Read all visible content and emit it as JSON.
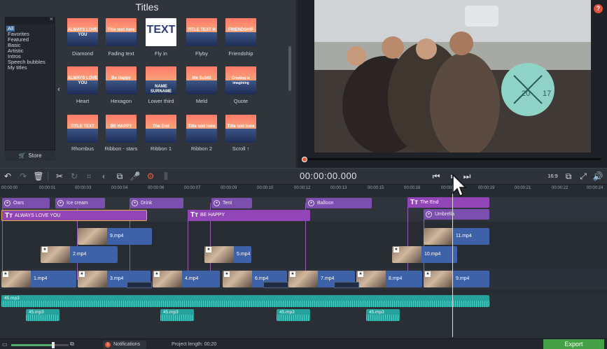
{
  "header": {
    "title": "Titles"
  },
  "categories": {
    "items": [
      "All",
      "Favorites",
      "Featured",
      "Basic",
      "Artistic",
      "Intros",
      "Speech bubbles",
      "My titles"
    ],
    "selected": "All",
    "store_label": "Store"
  },
  "tiles": [
    {
      "label": "Diamond",
      "text": "ALWAYS LOVE YOU"
    },
    {
      "label": "Fading text",
      "text": "Title text here"
    },
    {
      "label": "Fly in",
      "text": "TEXT"
    },
    {
      "label": "Flyby",
      "text": "TITLE TEXT H"
    },
    {
      "label": "Friendship",
      "text": "FRIENDSHIP"
    },
    {
      "label": "Heart",
      "text": "ALWAYS LOVE YOU"
    },
    {
      "label": "Hexagon",
      "text": "Be Happy"
    },
    {
      "label": "Lower third",
      "text": "NAME SURNAME"
    },
    {
      "label": "Meld",
      "text": "itle Subtit"
    },
    {
      "label": "Quote",
      "text": "Creating is imagining"
    },
    {
      "label": "Rhombus",
      "text": "TITLE TEXT"
    },
    {
      "label": "Ribbon - stars",
      "text": "BE HAPPY"
    },
    {
      "label": "Ribbon 1",
      "text": "The End"
    },
    {
      "label": "Ribbon 2",
      "text": "Title text here"
    },
    {
      "label": "Scroll ↑",
      "text": "Title text here"
    }
  ],
  "preview": {
    "badge_top": "20",
    "badge_right": "17",
    "help_label": "?"
  },
  "toolbar": {
    "timecode": "00:00:00.000",
    "aspect_ratio": "16:9"
  },
  "ruler": [
    "00:00:00",
    "00:00:01",
    "00:00:03",
    "00:00:04",
    "00:00:06",
    "00:00:07",
    "00:00:09",
    "00:00:10",
    "00:00:12",
    "00:00:13",
    "00:00:15",
    "00:00:16",
    "00:00:18",
    "00:00:19",
    "00:00:21",
    "00:00:22",
    "00:00:24"
  ],
  "sticker_clips": [
    "Oars",
    "Ice cream",
    "Drink",
    "Tent",
    "Balloon",
    "The End",
    "Umbrella"
  ],
  "title_clips": [
    "ALWAYS LOVE YOU",
    "BE HAPPY"
  ],
  "video_clips_top": [
    "9.mp4",
    "11.mp4"
  ],
  "video_clips_mid": [
    "2.mp4",
    "5.mp4",
    "10.mp4"
  ],
  "video_clips_main": [
    "1.mp4",
    "3.mp4",
    "4.mp4",
    "6.mp4",
    "7.mp4",
    "8.mp4",
    "9.mp4"
  ],
  "audio": {
    "main": "45.mp3",
    "small": [
      "45.mp3",
      "45.mp3",
      "45.mp3",
      "45.mp3"
    ]
  },
  "footer": {
    "notifications": "Notifications",
    "notification_count": "1",
    "project_length": "Project length:  00:20",
    "export": "Export"
  },
  "colors": {
    "accent_export": "#45a048",
    "title_track": "#9245b6",
    "video_track": "#3d62a8",
    "audio_track": "#27a29a"
  }
}
